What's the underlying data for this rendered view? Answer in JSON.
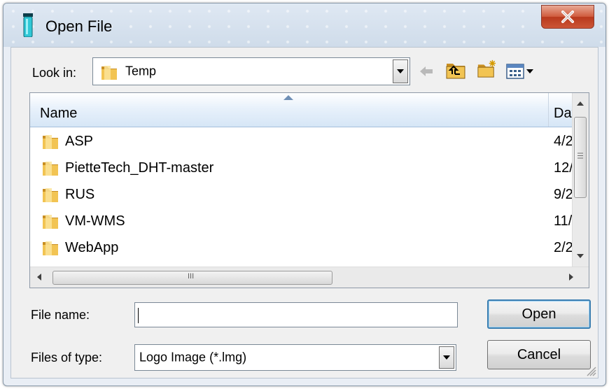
{
  "dialog": {
    "title": "Open File"
  },
  "look_in": {
    "label": "Look in:",
    "value": "Temp"
  },
  "file_list": {
    "columns": {
      "name": "Name",
      "date": "Dat"
    },
    "rows": [
      {
        "name": "ASP",
        "date": "4/2"
      },
      {
        "name": "PietteTech_DHT-master",
        "date": "12/"
      },
      {
        "name": "RUS",
        "date": "9/2"
      },
      {
        "name": "VM-WMS",
        "date": "11/"
      },
      {
        "name": "WebApp",
        "date": "2/2"
      }
    ],
    "hscroll_grip": "III"
  },
  "file_name": {
    "label": "File name:",
    "value": ""
  },
  "file_type": {
    "label": "Files of type:",
    "value": "Logo Image (*.lmg)"
  },
  "buttons": {
    "open": "Open",
    "cancel": "Cancel"
  },
  "icons": {
    "app": "app-icon",
    "folder": "folder-icon",
    "back": "back-arrow-icon",
    "up_folder": "up-one-level-icon",
    "new_folder": "new-folder-icon",
    "view_menu": "view-menu-icon",
    "close": "close-icon"
  },
  "colors": {
    "folder": "#e8b84a",
    "default_button_border": "#3c7fb1",
    "close_button": "#c8462a"
  }
}
